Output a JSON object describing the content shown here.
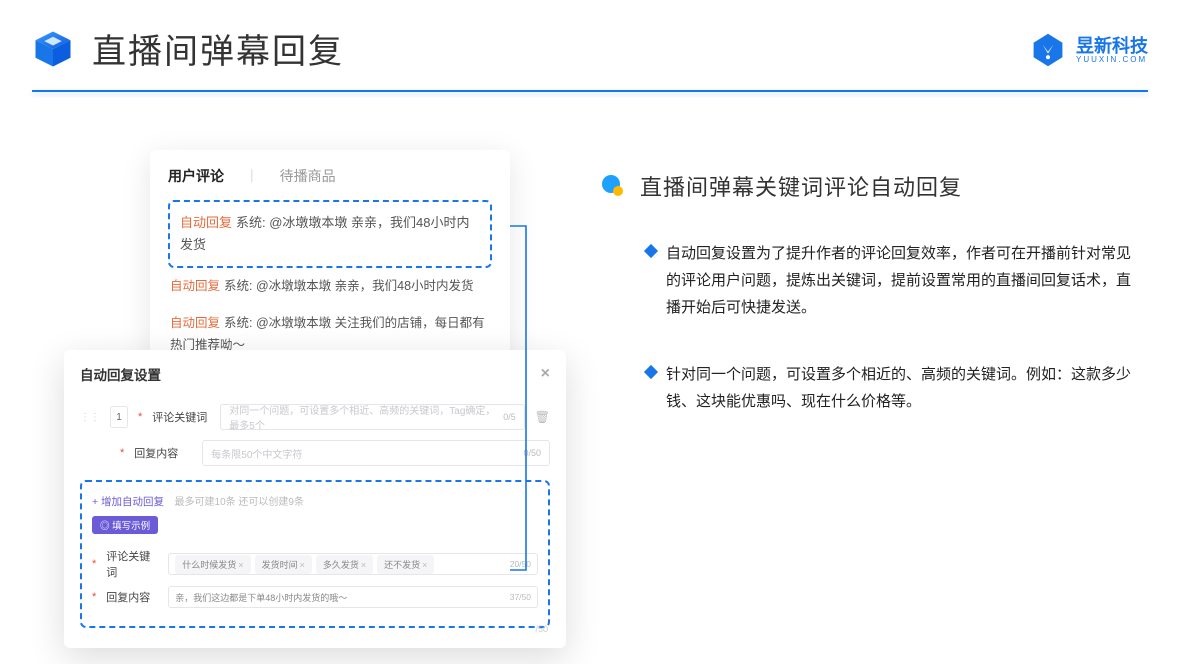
{
  "header": {
    "title": "直播间弹幕回复",
    "brand_name": "昱新科技",
    "brand_sub": "YUUXIN.COM"
  },
  "right": {
    "section_title": "直播间弹幕关键词评论自动回复",
    "bullets": [
      "自动回复设置为了提升作者的评论回复效率，作者可在开播前针对常见的评论用户问题，提炼出关键词，提前设置常用的直播间回复话术，直播开始后可快捷发送。",
      "针对同一个问题，可设置多个相近的、高频的关键词。例如：这款多少钱、这块能优惠吗、现在什么价格等。"
    ]
  },
  "card1": {
    "tab_active": "用户评论",
    "tab_inactive": "待播商品",
    "comments": [
      {
        "tag": "自动回复",
        "text": "系统: @冰墩墩本墩 亲亲，我们48小时内发货"
      },
      {
        "tag": "自动回复",
        "text": "系统: @冰墩墩本墩 亲亲，我们48小时内发货"
      },
      {
        "tag": "自动回复",
        "text": "系统: @冰墩墩本墩 关注我们的店铺，每日都有热门推荐呦～"
      }
    ]
  },
  "card2": {
    "modal_title": "自动回复设置",
    "idx": "1",
    "label_keyword": "评论关键词",
    "placeholder_keyword": "对同一个问题，可设置多个相近、高频的关键词，Tag确定，最多5个",
    "count_keyword": "0/5",
    "label_reply": "回复内容",
    "placeholder_reply": "每条限50个中文字符",
    "count_reply": "0/50",
    "add_link": "+ 增加自动回复",
    "add_hint": "最多可建10条 还可以创建9条",
    "pill": "◎ 填写示例",
    "ex_keyword_label": "评论关键词",
    "ex_chips": [
      "什么时候发货",
      "发货时间",
      "多久发货",
      "还不发货"
    ],
    "ex_keyword_count": "20/50",
    "ex_reply_label": "回复内容",
    "ex_reply_text": "亲，我们这边都是下单48小时内发货的哦～",
    "ex_reply_count": "37/50",
    "stray_count": "/50"
  }
}
